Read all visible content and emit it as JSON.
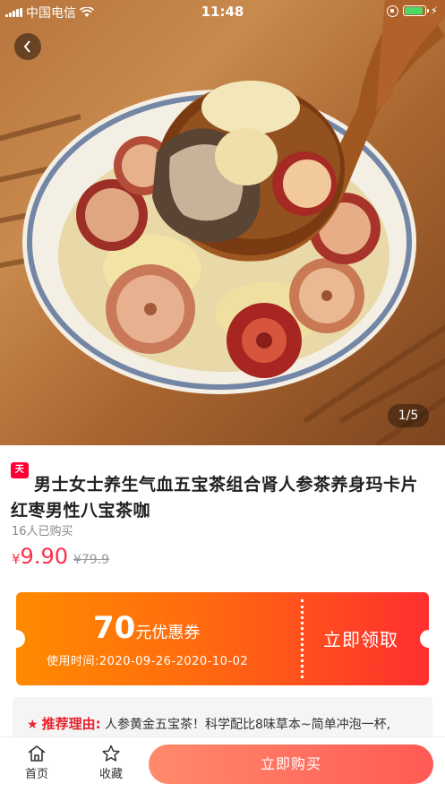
{
  "status_bar": {
    "carrier": "中国电信",
    "time": "11:48",
    "battery_color": "#4cd964"
  },
  "gallery": {
    "indicator": "1/5",
    "back_icon": "chevron-left-icon"
  },
  "product": {
    "platform_badge": "天猫",
    "title": "男士女士养生气血五宝茶组合肾人参茶养身玛卡片红枣男性八宝茶咖",
    "sold": "16人已购买",
    "currency": "¥",
    "price": "9.90",
    "original_price": "¥79.9"
  },
  "coupon": {
    "amount": "70",
    "amount_suffix": "元优惠券",
    "valid_time": "使用时间:2020-09-26-2020-10-02",
    "action": "立即领取"
  },
  "recommend": {
    "label": "推荐理由:",
    "text": "人参黄金五宝茶！科学配比8味草本~简单冲泡一杯,"
  },
  "bottom_bar": {
    "home": "首页",
    "favorite": "收藏",
    "buy": "立即购买"
  },
  "colors": {
    "accent_red": "#ff2d4a",
    "coupon_start": "#ff8a00",
    "coupon_end": "#ff2f2f"
  }
}
